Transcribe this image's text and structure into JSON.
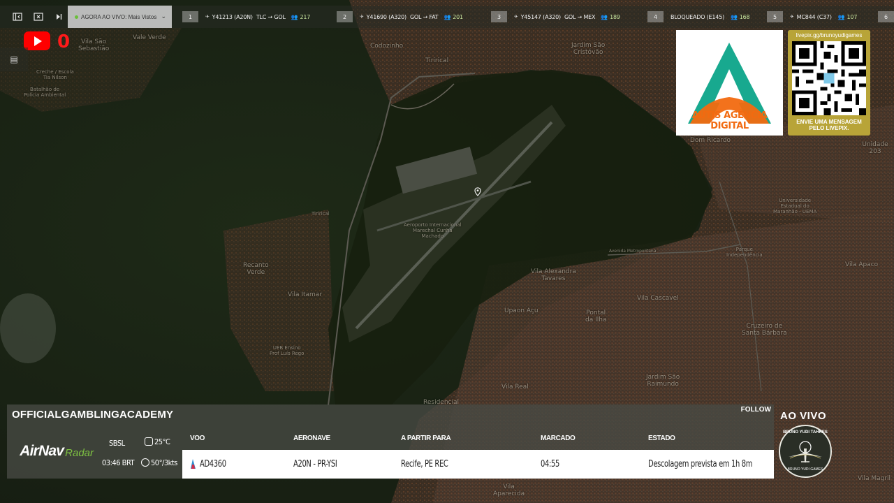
{
  "topbar": {
    "now_live_label": "AGORA AO VIVO: Mais Vistos",
    "flights": [
      {
        "rank": "1",
        "callsign": "Y41213 (A20N)",
        "route": "TLC → GOL",
        "count": "217"
      },
      {
        "rank": "2",
        "callsign": "Y41690 (A320)",
        "route": "GOL → FAT",
        "count": "201"
      },
      {
        "rank": "3",
        "callsign": "Y45147 (A320)",
        "route": "GOL → MEX",
        "count": "189"
      },
      {
        "rank": "4",
        "callsign": "BLOQUEADO (E145)",
        "route": "",
        "count": "168"
      },
      {
        "rank": "5",
        "callsign": "MC844 (C37)",
        "route": "",
        "count": "107"
      },
      {
        "rank": "6",
        "callsign": "",
        "route": "",
        "count": ""
      }
    ]
  },
  "youtube": {
    "count": "0"
  },
  "map_labels": [
    {
      "text": "Vale Verde"
    },
    {
      "text": "Vila São\nSebastião"
    },
    {
      "text": "Creche / Escola\nTia Nilson"
    },
    {
      "text": "Batalhão de\nPolícia Ambiental"
    },
    {
      "text": "Codozinho"
    },
    {
      "text": "Tirirical"
    },
    {
      "text": "Jardim São\nCristóvão"
    },
    {
      "text": "Aeroporto Internacional\nMarechal Cunha\nMachado"
    },
    {
      "text": "Recanto\nVerde"
    },
    {
      "text": "Vila Itamar"
    },
    {
      "text": "UEB Ensino\nProf Luís Rego"
    },
    {
      "text": "Vila Alexandra\nTavares"
    },
    {
      "text": "Upaon Açu"
    },
    {
      "text": "Pontal\nda Ilha"
    },
    {
      "text": "Vila Cascavel"
    },
    {
      "text": "Cruzeiro de\nSanta Bárbara"
    },
    {
      "text": "Jardim São\nRaimundo"
    },
    {
      "text": "Vila Real"
    },
    {
      "text": "Dom Ricardo"
    },
    {
      "text": "Universidade\nEstadual do\nMaranhão - UEMA"
    },
    {
      "text": "Parque\nIndependência"
    },
    {
      "text": "Vila Apaco"
    },
    {
      "text": "Avenida Metropolitana"
    },
    {
      "text": "Unidade 203"
    },
    {
      "text": "Vila Magril"
    },
    {
      "text": "Vila\nAparecida"
    },
    {
      "text": "Residencial"
    },
    {
      "text": "Tirirical"
    }
  ],
  "ads": {
    "agency_name": "AUTIS AGÊNCIA DIGITAL",
    "qr_url": "livepix.gg/brunoyudigames",
    "qr_message": "ENVIE UMA MENSAGEM\nPELO LIVEPIX."
  },
  "panel": {
    "channel": "OFFICIALGAMBLINGACADEMY",
    "follow": "FOLLOW",
    "brand_main": "AirNav",
    "brand_sub": "Radar",
    "airport": "SBSL",
    "time": "03:46 BRT",
    "temperature": "25°C",
    "wind": "50°/3kts",
    "headers": {
      "flight": "VOO",
      "aircraft": "AERONAVE",
      "route": "A PARTIR PARA",
      "scheduled": "MARCADO",
      "status": "ESTADO"
    },
    "row": {
      "flight": "AD4360",
      "aircraft": "A20N - PR-YSI",
      "route": "Recife, PE REC",
      "scheduled": "04:55",
      "status": "Descolagem prevista em 1h 8m"
    }
  },
  "badge": {
    "live": "AO VIVO",
    "top": "BRUNO YUDI TAHKES",
    "bottom": "BRUNO YUDI GAMES"
  },
  "colors": {
    "accent_green": "#7fc242",
    "youtube_red": "#ff0000",
    "agency_orange": "#f26a10",
    "livepix_gold": "#b8a438"
  }
}
